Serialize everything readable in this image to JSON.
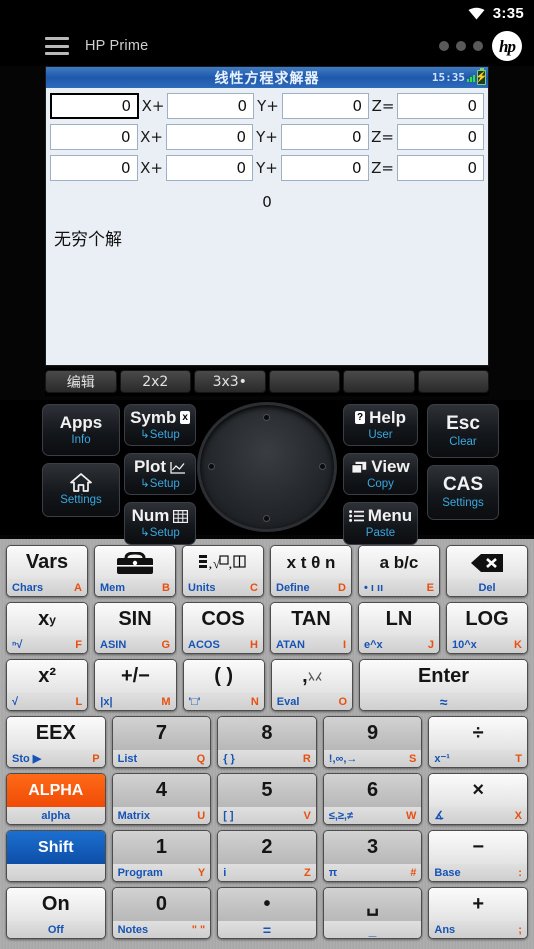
{
  "status_bar": {
    "wifi_icon": "wifi-icon",
    "time": "3:35"
  },
  "action_bar": {
    "menu_icon": "hamburger-menu-icon",
    "title": "HP Prime",
    "overflow_icon": "three-dots-icon",
    "logo": "hp"
  },
  "screen": {
    "title": "线性方程求解器",
    "clock": "15:35",
    "battery_icon": "battery-charging-icon",
    "signal_icon": "signal-bars-icon",
    "labels": {
      "x": "X+",
      "y": "Y+",
      "z": "Z="
    },
    "rows": [
      {
        "a": "0",
        "b": "0",
        "c": "0",
        "d": "0",
        "selected": true
      },
      {
        "a": "0",
        "b": "0",
        "c": "0",
        "d": "0",
        "selected": false
      },
      {
        "a": "0",
        "b": "0",
        "c": "0",
        "d": "0",
        "selected": false
      }
    ],
    "result_value": "0",
    "result_message": "无穷个解"
  },
  "softkeys": [
    {
      "label": "编辑"
    },
    {
      "label": "2x2"
    },
    {
      "label": "3x3•"
    },
    {
      "label": ""
    },
    {
      "label": ""
    },
    {
      "label": ""
    }
  ],
  "function_keys": {
    "left": [
      {
        "main": "Apps",
        "sub": "Info",
        "icon": ""
      },
      {
        "main": "",
        "sub": "Settings",
        "icon": "home-icon"
      }
    ],
    "left2": [
      {
        "main": "Symb",
        "sub": "↳Setup",
        "icon": "x-box-icon"
      },
      {
        "main": "Plot",
        "sub": "↳Setup",
        "icon": "chart-icon"
      },
      {
        "main": "Num",
        "sub": "↳Setup",
        "icon": "table-icon"
      }
    ],
    "right1": [
      {
        "main": "Help",
        "sub": "User",
        "icon": "question-box-icon"
      },
      {
        "main": "View",
        "sub": "Copy",
        "icon": "windows-icon"
      },
      {
        "main": "Menu",
        "sub": "Paste",
        "icon": "list-icon"
      }
    ],
    "right2": [
      {
        "main": "Esc",
        "sub": "Clear",
        "icon": ""
      },
      {
        "main": "CAS",
        "sub": "Settings",
        "icon": ""
      }
    ],
    "dpad_icon": "directional-pad"
  },
  "keyboard": {
    "rows": [
      [
        {
          "top": "Vars",
          "bl": "Chars",
          "br": "A",
          "numpad": false
        },
        {
          "top": "",
          "icon": "toolbox-icon",
          "bl": "Mem",
          "br": "B",
          "numpad": false
        },
        {
          "top": "",
          "icon": "units-icon",
          "bl": "Units",
          "br": "C",
          "numpad": false
        },
        {
          "top": "x t θ n",
          "bl": "Define",
          "br": "D",
          "numpad": false
        },
        {
          "top": "a b/c",
          "bl": "• ı ıı",
          "br": "E",
          "numpad": false
        },
        {
          "top": "",
          "icon": "backspace-icon",
          "bl": "",
          "br": "",
          "center": "Del",
          "numpad": false
        }
      ],
      [
        {
          "top": "x^y",
          "bl": "ⁿ√",
          "br": "F",
          "numpad": false
        },
        {
          "top": "SIN",
          "bl": "ASIN",
          "br": "G",
          "numpad": false
        },
        {
          "top": "COS",
          "bl": "ACOS",
          "br": "H",
          "numpad": false
        },
        {
          "top": "TAN",
          "bl": "ATAN",
          "br": "I",
          "numpad": false
        },
        {
          "top": "LN",
          "bl": "e^x",
          "br": "J",
          "numpad": false
        },
        {
          "top": "LOG",
          "bl": "10^x",
          "br": "K",
          "numpad": false
        }
      ],
      [
        {
          "top": "x²",
          "bl": "√",
          "br": "L",
          "numpad": false
        },
        {
          "top": "+/−",
          "bl": "|x|",
          "br": "M",
          "numpad": false
        },
        {
          "top": "( )",
          "bl": "'□'",
          "br": "N",
          "numpad": false
        },
        {
          "top": ",",
          "icon": "shuffle-icon",
          "bl": "Eval",
          "br": "O",
          "numpad": false
        },
        {
          "top": "Enter",
          "center": "≈",
          "wide": true,
          "numpad": false
        }
      ],
      [
        {
          "top": "EEX",
          "bl": "Sto ▶",
          "br": "P",
          "numpad": false
        },
        {
          "top": "7",
          "bl": "List",
          "br": "Q",
          "numpad": true
        },
        {
          "top": "8",
          "bl": "{ }",
          "br": "R",
          "numpad": true
        },
        {
          "top": "9",
          "bl": "!,∞,→",
          "br": "S",
          "numpad": true
        },
        {
          "top": "÷",
          "bl": "x⁻¹",
          "br": "T",
          "numpad": false
        }
      ],
      [
        {
          "top": "ALPHA",
          "center": "alpha",
          "style": "alpha",
          "numpad": false
        },
        {
          "top": "4",
          "bl": "Matrix",
          "br": "U",
          "numpad": true
        },
        {
          "top": "5",
          "bl": "[ ]",
          "br": "V",
          "numpad": true
        },
        {
          "top": "6",
          "bl": "≤,≥,≠",
          "br": "W",
          "numpad": true
        },
        {
          "top": "×",
          "bl": "∡",
          "br": "X",
          "numpad": false
        }
      ],
      [
        {
          "top": "Shift",
          "center": "",
          "style": "shift",
          "numpad": false
        },
        {
          "top": "1",
          "bl": "Program",
          "br": "Y",
          "numpad": true
        },
        {
          "top": "2",
          "bl": "i",
          "br": "Z",
          "numpad": true
        },
        {
          "top": "3",
          "bl": "π",
          "br": "#",
          "numpad": true
        },
        {
          "top": "−",
          "bl": "Base",
          "br": ":",
          "numpad": false
        }
      ],
      [
        {
          "top": "On",
          "center": "Off",
          "numpad": false
        },
        {
          "top": "0",
          "bl": "Notes",
          "br": "\" \"",
          "numpad": true
        },
        {
          "top": "•",
          "center": "=",
          "numpad": true
        },
        {
          "top": "␣",
          "center": "_",
          "numpad": true
        },
        {
          "top": "+",
          "bl": "Ans",
          "br": ";",
          "numpad": false
        }
      ]
    ]
  },
  "colors": {
    "accent_blue": "#1553b5",
    "accent_orange": "#e8500f",
    "screen_header": "#1f58ab",
    "alpha_key": "#ef4b06",
    "shift_key": "#0d4fa8"
  }
}
